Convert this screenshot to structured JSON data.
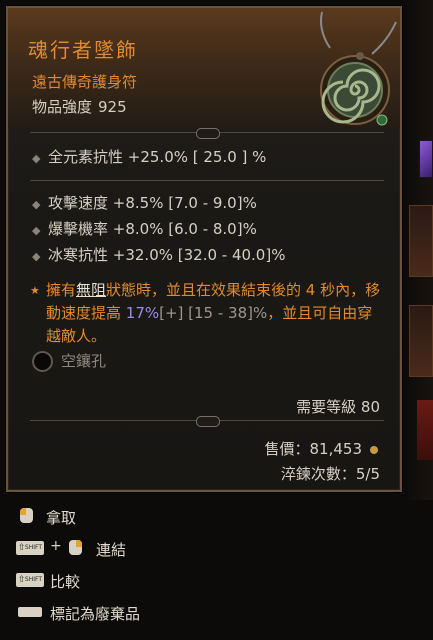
{
  "item": {
    "name": "魂行者墜飾",
    "type": "遠古傳奇護身符",
    "power_label": "物品強度",
    "power_value": "925"
  },
  "implicit": {
    "text": "全元素抗性 +25.0%  [ 25.0 ] %"
  },
  "affixes": [
    {
      "text": "攻擊速度 +8.5% [7.0 - 9.0]%"
    },
    {
      "text": "爆擊機率 +8.0% [6.0 - 8.0]%"
    },
    {
      "text": "冰寒抗性 +32.0% [32.0 - 40.0]%"
    }
  ],
  "legendary": {
    "part1": "擁有",
    "keyword": "無阻",
    "part2": "狀態時，並且在效果結束後的 4 秒內，移動速度提高 ",
    "value": "17%",
    "bracket": "[+] [15 - 38]%",
    "part3": "，並且可自由穿越敵人。"
  },
  "socket": {
    "label": "空鑲孔"
  },
  "requirement": {
    "text": "需要等級 80"
  },
  "price": {
    "text": "售價：81,453"
  },
  "rerolls": {
    "text": "淬鍊次數：5/5"
  },
  "actions": {
    "take": "拿取",
    "link": "連結",
    "compare": "比較",
    "mark_junk": "標記為廢棄品",
    "shift_key": "SHIFT"
  },
  "colors": {
    "legendary_orange": "#e2892f",
    "value_purple": "#9b8ce8",
    "border_gold": "#6b5438"
  },
  "icons": {
    "amulet": "spiral-amulet-icon",
    "bullet": "diamond-bullet-icon",
    "legendary": "star-bullet-icon",
    "socket": "empty-socket-icon",
    "gold": "gold-coin-icon"
  }
}
